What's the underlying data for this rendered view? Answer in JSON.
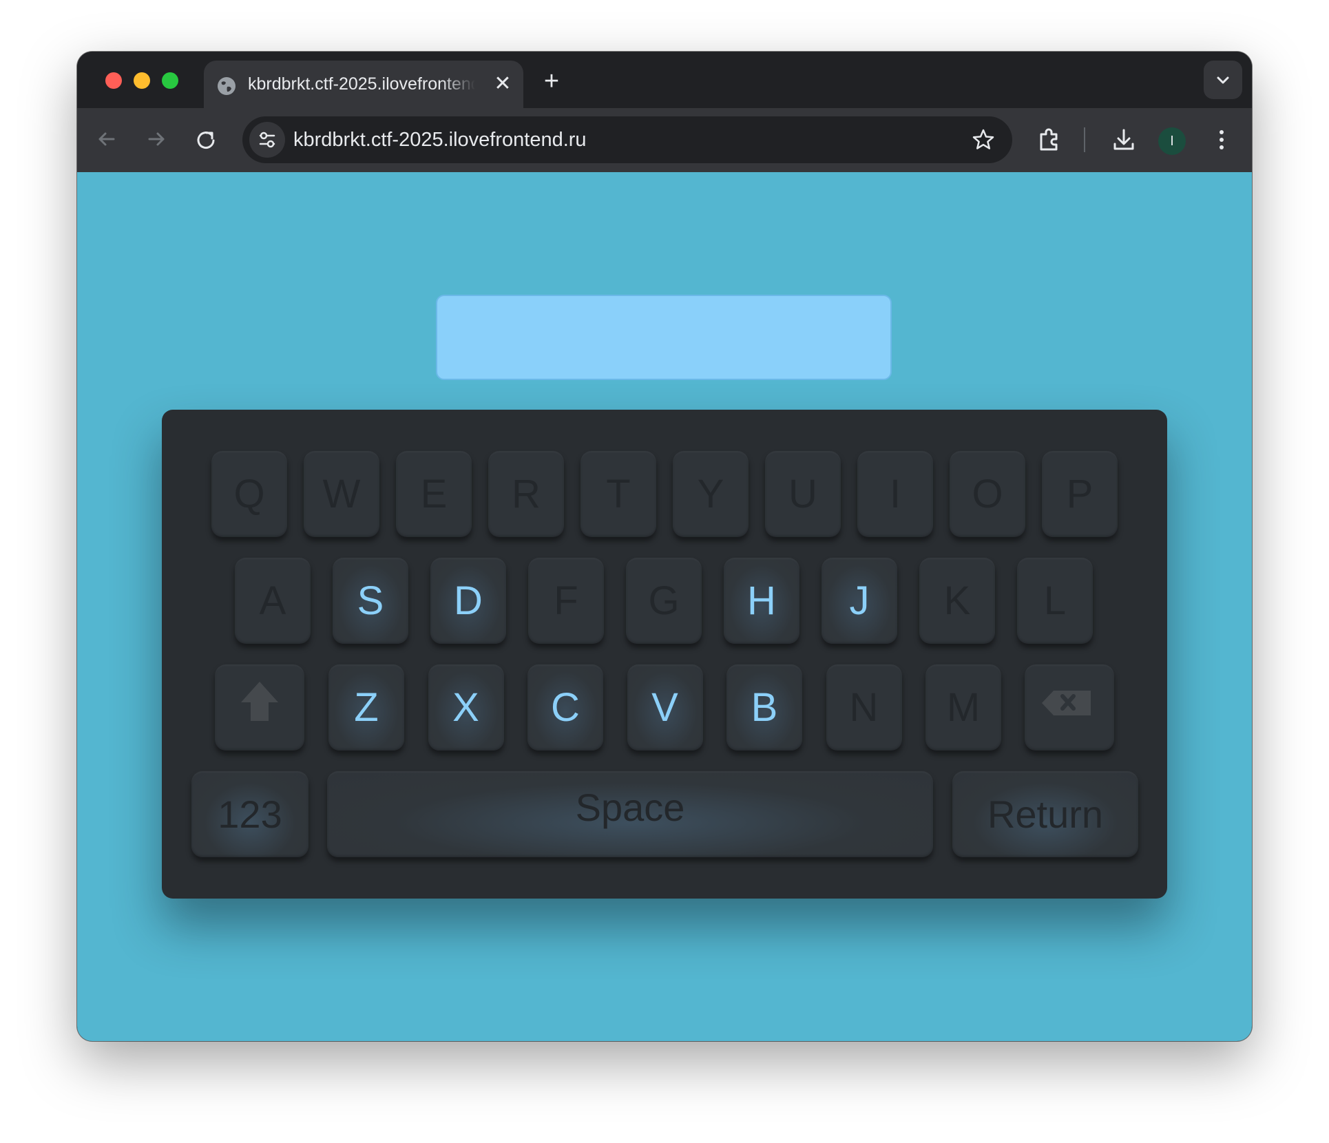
{
  "browser": {
    "tab_title": "kbrdbrkt.ctf-2025.ilovefrontend.ru",
    "tab_close": "✕",
    "new_tab": "+",
    "address": "kbrdbrkt.ctf-2025.ilovefrontend.ru",
    "profile_initial": "I"
  },
  "page": {
    "display_value": "",
    "background_color": "#54b6d0",
    "display_color": "#8ad0fa",
    "keyboard_color": "#292d31",
    "lit_key_color": "#8cd0f9"
  },
  "keyboard": {
    "row1": [
      {
        "label": "Q",
        "lit": false
      },
      {
        "label": "W",
        "lit": false
      },
      {
        "label": "E",
        "lit": false
      },
      {
        "label": "R",
        "lit": false
      },
      {
        "label": "T",
        "lit": false
      },
      {
        "label": "Y",
        "lit": false
      },
      {
        "label": "U",
        "lit": false
      },
      {
        "label": "I",
        "lit": false
      },
      {
        "label": "O",
        "lit": false
      },
      {
        "label": "P",
        "lit": false
      }
    ],
    "row2": [
      {
        "label": "A",
        "lit": false
      },
      {
        "label": "S",
        "lit": true
      },
      {
        "label": "D",
        "lit": true
      },
      {
        "label": "F",
        "lit": false
      },
      {
        "label": "G",
        "lit": false
      },
      {
        "label": "H",
        "lit": true
      },
      {
        "label": "J",
        "lit": true
      },
      {
        "label": "K",
        "lit": false
      },
      {
        "label": "L",
        "lit": false
      }
    ],
    "row3": [
      {
        "label": "Z",
        "lit": true
      },
      {
        "label": "X",
        "lit": true
      },
      {
        "label": "C",
        "lit": true
      },
      {
        "label": "V",
        "lit": true
      },
      {
        "label": "B",
        "lit": true
      },
      {
        "label": "N",
        "lit": false
      },
      {
        "label": "M",
        "lit": false
      }
    ],
    "shift_icon": "shift-arrow-icon",
    "backspace_icon": "backspace-icon",
    "num_label": "123",
    "space_label": "Space",
    "return_label": "Return"
  }
}
